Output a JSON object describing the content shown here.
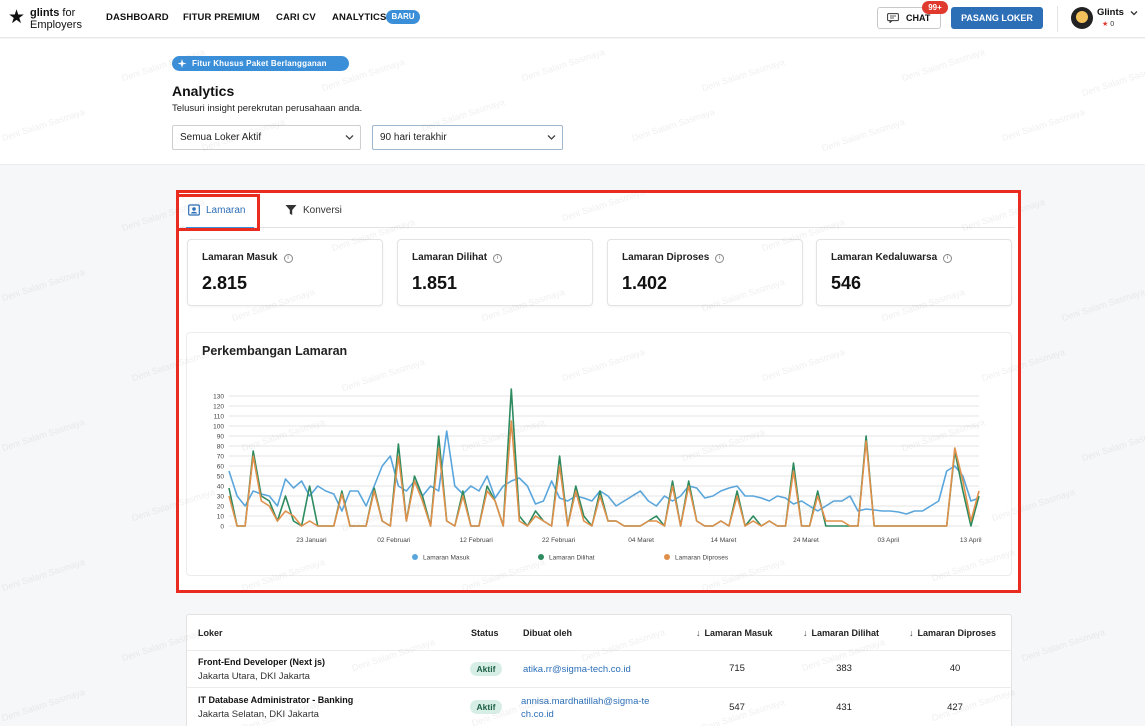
{
  "nav": {
    "logo_brand": "glints",
    "logo_for": " for",
    "logo_sub": "Employers",
    "items": [
      "DASHBOARD",
      "FITUR PREMIUM",
      "CARI CV",
      "ANALYTICS"
    ],
    "analytics_badge": "BARU",
    "chat_label": "CHAT",
    "chat_badge": "99+",
    "post_job_label": "PASANG LOKER",
    "user_name": "Glints",
    "user_points": "0"
  },
  "header": {
    "feature_pill": "Fitur Khusus Paket Berlangganan",
    "title": "Analytics",
    "subtitle": "Telusuri insight perekrutan perusahaan anda.",
    "job_filter": "Semua Loker Aktif",
    "period_filter": "90 hari terakhir"
  },
  "tabs": [
    {
      "label": "Lamaran",
      "active": true
    },
    {
      "label": "Konversi",
      "active": false
    }
  ],
  "stats": [
    {
      "label": "Lamaran Masuk",
      "value": "2.815"
    },
    {
      "label": "Lamaran Dilihat",
      "value": "1.851"
    },
    {
      "label": "Lamaran Diproses",
      "value": "1.402"
    },
    {
      "label": "Lamaran Kedaluwarsa",
      "value": "546"
    }
  ],
  "chart_data": {
    "type": "line",
    "title": "Perkembangan Lamaran",
    "ylim": [
      0,
      130
    ],
    "yticks": [
      0,
      10,
      20,
      30,
      40,
      50,
      60,
      70,
      80,
      90,
      100,
      110,
      120,
      130
    ],
    "xlim": [
      "2024-01-13",
      "2024-04-13"
    ],
    "xticks": [
      "23 Januari",
      "02 Februari",
      "12 Februari",
      "22 Februari",
      "04 Maret",
      "14 Maret",
      "24 Maret",
      "03 April",
      "13 April"
    ],
    "grid": true,
    "legend_position": "bottom",
    "series": [
      {
        "name": "Lamaran Masuk",
        "color": "#5aa6dc",
        "values": [
          55,
          30,
          20,
          35,
          32,
          30,
          20,
          47,
          38,
          45,
          30,
          40,
          35,
          32,
          15,
          35,
          35,
          20,
          40,
          60,
          70,
          40,
          35,
          45,
          30,
          40,
          35,
          95,
          40,
          32,
          40,
          35,
          50,
          28,
          40,
          45,
          48,
          40,
          22,
          25,
          45,
          28,
          25,
          30,
          28,
          25,
          35,
          30,
          20,
          25,
          30,
          35,
          25,
          20,
          30,
          25,
          30,
          40,
          38,
          28,
          30,
          35,
          38,
          40,
          30,
          30,
          28,
          25,
          30,
          28,
          22,
          25,
          20,
          15,
          20,
          25,
          25,
          30,
          15,
          17,
          16,
          15,
          15,
          14,
          12,
          15,
          15,
          20,
          25,
          55,
          60,
          50,
          25,
          28
        ]
      },
      {
        "name": "Lamaran Dilihat",
        "color": "#2e8b5f",
        "values": [
          38,
          0,
          0,
          75,
          30,
          25,
          5,
          30,
          5,
          0,
          40,
          0,
          0,
          0,
          35,
          0,
          0,
          0,
          38,
          5,
          0,
          82,
          5,
          50,
          30,
          0,
          90,
          5,
          0,
          35,
          0,
          0,
          40,
          25,
          0,
          137,
          10,
          0,
          15,
          5,
          0,
          70,
          0,
          40,
          10,
          0,
          35,
          5,
          5,
          0,
          0,
          0,
          5,
          10,
          0,
          45,
          0,
          45,
          5,
          0,
          0,
          5,
          0,
          35,
          0,
          10,
          0,
          5,
          0,
          0,
          63,
          0,
          0,
          35,
          0,
          0,
          0,
          0,
          0,
          90,
          0,
          0,
          0,
          0,
          0,
          0,
          0,
          0,
          0,
          0,
          75,
          35,
          0,
          30
        ]
      },
      {
        "name": "Lamaran Diproses",
        "color": "#e0904a",
        "values": [
          30,
          0,
          0,
          70,
          25,
          20,
          5,
          15,
          10,
          0,
          5,
          0,
          0,
          0,
          32,
          0,
          0,
          0,
          35,
          5,
          0,
          70,
          5,
          45,
          25,
          0,
          78,
          5,
          0,
          30,
          0,
          0,
          35,
          25,
          0,
          105,
          5,
          0,
          10,
          5,
          0,
          60,
          0,
          35,
          5,
          0,
          30,
          5,
          5,
          0,
          0,
          0,
          5,
          5,
          0,
          40,
          0,
          40,
          5,
          0,
          0,
          5,
          0,
          30,
          0,
          5,
          0,
          5,
          0,
          0,
          55,
          0,
          0,
          30,
          5,
          5,
          5,
          0,
          0,
          85,
          0,
          0,
          0,
          0,
          0,
          0,
          0,
          0,
          0,
          0,
          78,
          45,
          5,
          35
        ]
      }
    ]
  },
  "table": {
    "headers": {
      "job": "Loker",
      "status": "Status",
      "created_by": "Dibuat oleh",
      "received": "Lamaran Masuk",
      "viewed": "Lamaran Dilihat",
      "processed": "Lamaran Diproses"
    },
    "rows": [
      {
        "title": "Front-End Developer (Next js)",
        "location": "Jakarta Utara, DKI Jakarta",
        "status": "Aktif",
        "email": "atika.rr@sigma-tech.co.id",
        "received": "715",
        "viewed": "383",
        "processed": "40"
      },
      {
        "title": "IT Database Administrator - Banking",
        "location": "Jakarta Selatan, DKI Jakarta",
        "status": "Aktif",
        "email": "annisa.mardhatillah@sigma-tech.co.id",
        "received": "547",
        "viewed": "431",
        "processed": "427"
      }
    ]
  },
  "watermark": "Deni Salam Sasmaya"
}
